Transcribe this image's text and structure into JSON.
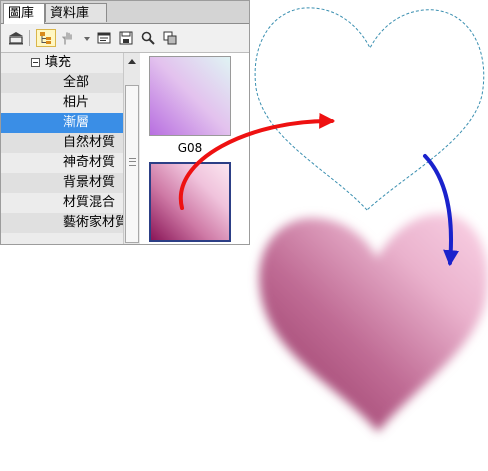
{
  "tabs": [
    {
      "label": "圖庫",
      "active": true
    },
    {
      "label": "資料庫",
      "active": false
    }
  ],
  "toolbar": {
    "buttons": [
      {
        "icon": "library-icon"
      },
      {
        "icon": "tree-view-icon",
        "pressed": true
      },
      {
        "icon": "hand-icon"
      },
      {
        "icon": "properties-icon"
      },
      {
        "icon": "save-icon"
      },
      {
        "icon": "search-icon"
      },
      {
        "icon": "copy-icon"
      }
    ]
  },
  "tree": {
    "root": "填充",
    "items": [
      "全部",
      "相片",
      "漸層",
      "自然材質",
      "神奇材質",
      "背景材質",
      "材質混合",
      "藝術家材質"
    ],
    "selected": "漸層"
  },
  "gallery": {
    "swatches": [
      {
        "label": "G08"
      },
      {
        "label": "",
        "selected": true
      }
    ]
  },
  "colors": {
    "selection": "#3a8ee6",
    "red_arrow": "#ee1111",
    "blue_arrow": "#1a22cc",
    "heart_pink": "#f6b9d6",
    "heart_dark": "#a8476f"
  }
}
